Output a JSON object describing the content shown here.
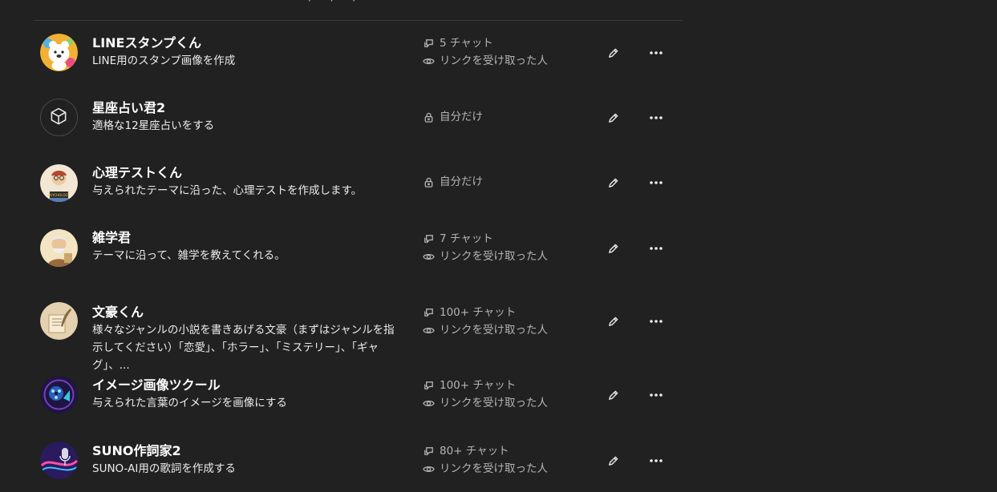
{
  "gpts": [
    {
      "name": "LINEスタンプくん",
      "desc_lines": [
        "LINE用のスタンプ画像を作成"
      ],
      "visibility": "link",
      "chats": "5 チャット",
      "link_label": "リンクを受け取った人",
      "icon": "bear-sticker-avatar"
    },
    {
      "name": "星座占い君2",
      "desc_lines": [
        "適格な12星座占いをする"
      ],
      "visibility": "private",
      "private_label": "自分だけ",
      "icon": "cube-placeholder-icon"
    },
    {
      "name": "心理テストくん",
      "desc_lines": [
        "与えられたテーマに沿った、心理テストを作成します。"
      ],
      "visibility": "private",
      "private_label": "自分だけ",
      "icon": "psychology-test-avatar"
    },
    {
      "name": "雑学君",
      "desc_lines": [
        "テーマに沿って、雑学を教えてくれる。"
      ],
      "visibility": "link",
      "chats": "7 チャット",
      "link_label": "リンクを受け取った人",
      "icon": "scholar-avatar"
    },
    {
      "name": "文豪くん",
      "desc_lines": [
        "様々なジャンルの小説を書きあげる文豪（まずはジャンルを指",
        "示してください）「恋愛」、「ホラー」、「ミステリー」、「ギャグ」、..."
      ],
      "visibility": "link",
      "chats": "100+ チャット",
      "link_label": "リンクを受け取った人",
      "icon": "quill-avatar"
    },
    {
      "name": "イメージ画像ツクール",
      "desc_lines": [
        "与えられた言葉のイメージを画像にする"
      ],
      "visibility": "link",
      "chats": "100+ チャット",
      "link_label": "リンクを受け取った人",
      "icon": "film-reel-avatar"
    },
    {
      "name": "SUNO作詞家2",
      "desc_lines": [
        "SUNO-AI用の歌詞を作成する"
      ],
      "visibility": "link",
      "chats": "80+ チャット",
      "link_label": "リンクを受け取った人",
      "icon": "microphone-avatar"
    }
  ],
  "colors": {
    "background": "#212121",
    "text": "#ececec",
    "muted": "#b4b4b4",
    "divider": "#3a3a3a"
  }
}
